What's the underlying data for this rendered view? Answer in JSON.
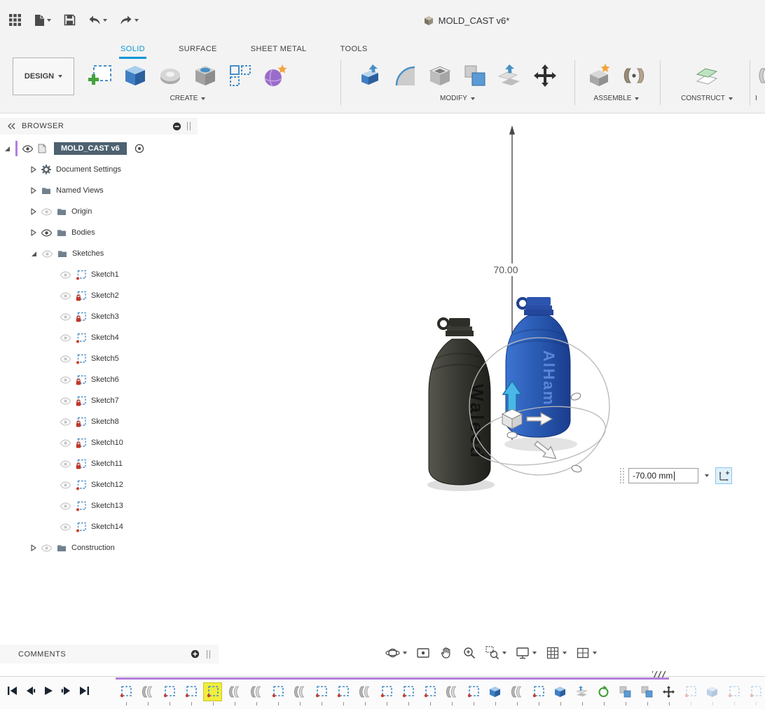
{
  "app": {
    "title": "MOLD_CAST v6*"
  },
  "titlebar": {
    "icons": [
      "app-grid",
      "new-file",
      "save",
      "undo",
      "redo"
    ]
  },
  "ribbon": {
    "design_button_label": "DESIGN",
    "tabs": [
      {
        "label": "SOLID",
        "active": true
      },
      {
        "label": "SURFACE",
        "active": false
      },
      {
        "label": "SHEET METAL",
        "active": false
      },
      {
        "label": "TOOLS",
        "active": false
      }
    ],
    "groups": {
      "create": {
        "label": "CREATE",
        "icons": [
          "create-sketch",
          "box",
          "revolve",
          "cylinder",
          "rectangular-pattern",
          "create-form"
        ]
      },
      "modify": {
        "label": "MODIFY",
        "icons": [
          "press-pull",
          "fillet",
          "shell",
          "combine",
          "offset-face",
          "move-copy"
        ]
      },
      "assemble": {
        "label": "ASSEMBLE",
        "icons": [
          "new-component",
          "joint"
        ]
      },
      "construct": {
        "label": "CONSTRUCT",
        "icons": [
          "offset-plane"
        ]
      },
      "inspect_partial": {
        "label": "I"
      }
    }
  },
  "browser": {
    "header": "BROWSER",
    "root": {
      "label": "MOLD_CAST v6",
      "visible": true,
      "active": true
    },
    "items": [
      {
        "label": "Document Settings",
        "icon": "gear",
        "eye": null
      },
      {
        "label": "Named Views",
        "icon": "folder",
        "eye": null
      },
      {
        "label": "Origin",
        "icon": "folder",
        "eye": "hidden"
      },
      {
        "label": "Bodies",
        "icon": "folder",
        "eye": "visible"
      },
      {
        "label": "Sketches",
        "icon": "folder",
        "eye": "hidden",
        "expanded": true
      }
    ],
    "sketches": [
      {
        "label": "Sketch1",
        "locked": false
      },
      {
        "label": "Sketch2",
        "locked": true
      },
      {
        "label": "Sketch3",
        "locked": true
      },
      {
        "label": "Sketch4",
        "locked": false
      },
      {
        "label": "Sketch5",
        "locked": false
      },
      {
        "label": "Sketch6",
        "locked": true
      },
      {
        "label": "Sketch7",
        "locked": true
      },
      {
        "label": "Sketch8",
        "locked": true
      },
      {
        "label": "Sketch10",
        "locked": true
      },
      {
        "label": "Sketch11",
        "locked": true
      },
      {
        "label": "Sketch12",
        "locked": false
      },
      {
        "label": "Sketch13",
        "locked": false
      },
      {
        "label": "Sketch14",
        "locked": false
      }
    ],
    "construction": {
      "label": "Construction",
      "icon": "folder",
      "eye": "hidden"
    }
  },
  "viewport": {
    "axis_dimension_label": "70.00",
    "bottles": [
      {
        "engraving": "Waleed",
        "body_color": "#3b3b36"
      },
      {
        "engraving": "AlHam",
        "body_color": "#2757ae"
      }
    ],
    "dimension_input": {
      "value": "-70.00 mm"
    }
  },
  "comments": {
    "header": "COMMENTS"
  },
  "view_toolbar": {
    "icons": [
      "orbit",
      "look-at",
      "pan",
      "zoom",
      "window-zoom",
      "display-settings",
      "grid-display",
      "viewports"
    ]
  },
  "timeline": {
    "playback_icons": [
      "go-to-start",
      "step-back",
      "play",
      "step-forward",
      "go-to-end"
    ],
    "highlight_color": "#f1ee3c",
    "marker_color": "#b57edc",
    "features": [
      {
        "type": "sketch"
      },
      {
        "type": "revolve"
      },
      {
        "type": "sketch"
      },
      {
        "type": "sketch"
      },
      {
        "type": "sketch",
        "highlighted": true
      },
      {
        "type": "revolve"
      },
      {
        "type": "revolve"
      },
      {
        "type": "sketch"
      },
      {
        "type": "revolve"
      },
      {
        "type": "sketch"
      },
      {
        "type": "sketch"
      },
      {
        "type": "revolve"
      },
      {
        "type": "sketch"
      },
      {
        "type": "sketch"
      },
      {
        "type": "sketch"
      },
      {
        "type": "revolve"
      },
      {
        "type": "sketch"
      },
      {
        "type": "extrude"
      },
      {
        "type": "revolve"
      },
      {
        "type": "sketch"
      },
      {
        "type": "extrude"
      },
      {
        "type": "offset"
      },
      {
        "type": "pattern"
      },
      {
        "type": "combine"
      },
      {
        "type": "combine"
      },
      {
        "type": "move"
      },
      {
        "type": "sketch",
        "dimmed": true
      },
      {
        "type": "extrude",
        "dimmed": true
      },
      {
        "type": "sketch",
        "dimmed": true
      },
      {
        "type": "sketch",
        "dimmed": true
      }
    ]
  },
  "colors": {
    "accent_blue": "#0696d7",
    "selection_purple": "#b57edc",
    "root_highlight": "#4d6170"
  }
}
